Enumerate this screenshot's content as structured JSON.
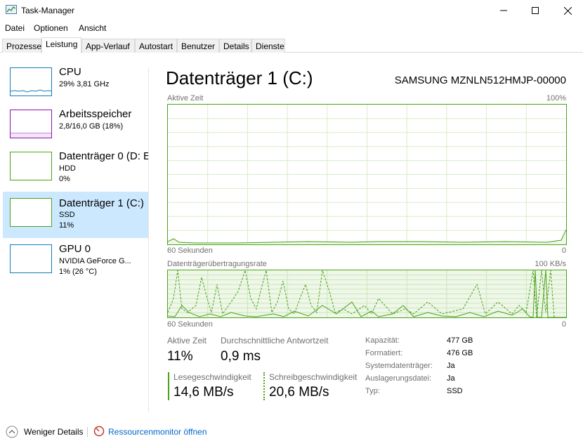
{
  "window": {
    "title": "Task-Manager"
  },
  "menu": [
    "Datei",
    "Optionen",
    "Ansicht"
  ],
  "tabs": [
    "Prozesse",
    "Leistung",
    "App-Verlauf",
    "Autostart",
    "Benutzer",
    "Details",
    "Dienste"
  ],
  "active_tab": "Leistung",
  "sidebar": {
    "items": [
      {
        "name": "CPU",
        "line1": "29% 3,81 GHz",
        "line2": ""
      },
      {
        "name": "Arbeitsspeicher",
        "line1": "2,8/16,0 GB (18%)",
        "line2": ""
      },
      {
        "name": "Datenträger 0 (D: E",
        "line1": "HDD",
        "line2": "0%"
      },
      {
        "name": "Datenträger 1 (C:)",
        "line1": "SSD",
        "line2": "11%"
      },
      {
        "name": "GPU 0",
        "line1": "NVIDIA GeForce G...",
        "line2": "1% (26 °C)"
      }
    ],
    "selected_index": 3
  },
  "detail": {
    "title": "Datenträger 1 (C:)",
    "model": "SAMSUNG MZNLN512HMJP-00000",
    "graph1": {
      "label": "Aktive Zeit",
      "max": "100%",
      "time": "60 Sekunden",
      "min": "0"
    },
    "graph2": {
      "label": "Datenträgerübertragungsrate",
      "max": "100 KB/s",
      "time": "60 Sekunden",
      "min": "0"
    },
    "stats": {
      "active_time_label": "Aktive Zeit",
      "active_time_value": "11%",
      "response_label": "Durchschnittliche Antwortzeit",
      "response_value": "0,9 ms",
      "read_label": "Lesegeschwindigkeit",
      "read_value": "14,6 MB/s",
      "write_label": "Schreibgeschwindigkeit",
      "write_value": "20,6 MB/s"
    },
    "info": [
      {
        "label": "Kapazität:",
        "value": "477 GB"
      },
      {
        "label": "Formatiert:",
        "value": "476 GB"
      },
      {
        "label": "Systemdatenträger:",
        "value": "Ja"
      },
      {
        "label": "Auslagerungsdatei:",
        "value": "Ja"
      },
      {
        "label": "Typ:",
        "value": "SSD"
      }
    ]
  },
  "footer": {
    "fewer_details": "Weniger Details",
    "resource_monitor": "Ressourcenmonitor öffnen"
  },
  "colors": {
    "disk_green": "#4aa118",
    "cpu_blue": "#117dbb",
    "memory_purple": "#8b12ae",
    "selected_bg": "#cce8ff",
    "link_blue": "#0066cc"
  }
}
